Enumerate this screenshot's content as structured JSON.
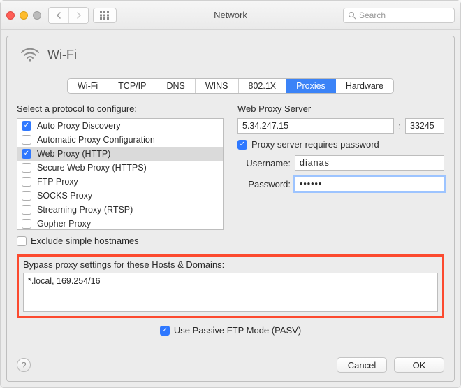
{
  "window": {
    "title": "Network",
    "search_placeholder": "Search"
  },
  "header": {
    "interface": "Wi-Fi"
  },
  "tabs": [
    "Wi-Fi",
    "TCP/IP",
    "DNS",
    "WINS",
    "802.1X",
    "Proxies",
    "Hardware"
  ],
  "active_tab": "Proxies",
  "left": {
    "label": "Select a protocol to configure:",
    "protocols": [
      {
        "name": "Auto Proxy Discovery",
        "checked": true,
        "selected": false
      },
      {
        "name": "Automatic Proxy Configuration",
        "checked": false,
        "selected": false
      },
      {
        "name": "Web Proxy (HTTP)",
        "checked": true,
        "selected": true
      },
      {
        "name": "Secure Web Proxy (HTTPS)",
        "checked": false,
        "selected": false
      },
      {
        "name": "FTP Proxy",
        "checked": false,
        "selected": false
      },
      {
        "name": "SOCKS Proxy",
        "checked": false,
        "selected": false
      },
      {
        "name": "Streaming Proxy (RTSP)",
        "checked": false,
        "selected": false
      },
      {
        "name": "Gopher Proxy",
        "checked": false,
        "selected": false
      }
    ],
    "exclude_label": "Exclude simple hostnames",
    "exclude_checked": false
  },
  "right": {
    "server_label": "Web Proxy Server",
    "host": "5.34.247.15",
    "port_sep": ":",
    "port": "33245",
    "requires_pw": true,
    "requires_pw_label": "Proxy server requires password",
    "username_label": "Username:",
    "username": "dianas",
    "password_label": "Password:",
    "password_mask": "••••••"
  },
  "bypass": {
    "label": "Bypass proxy settings for these Hosts & Domains:",
    "value": "*.local, 169.254/16"
  },
  "pasv": {
    "label": "Use Passive FTP Mode (PASV)",
    "checked": true
  },
  "footer": {
    "help": "?",
    "cancel": "Cancel",
    "ok": "OK"
  }
}
